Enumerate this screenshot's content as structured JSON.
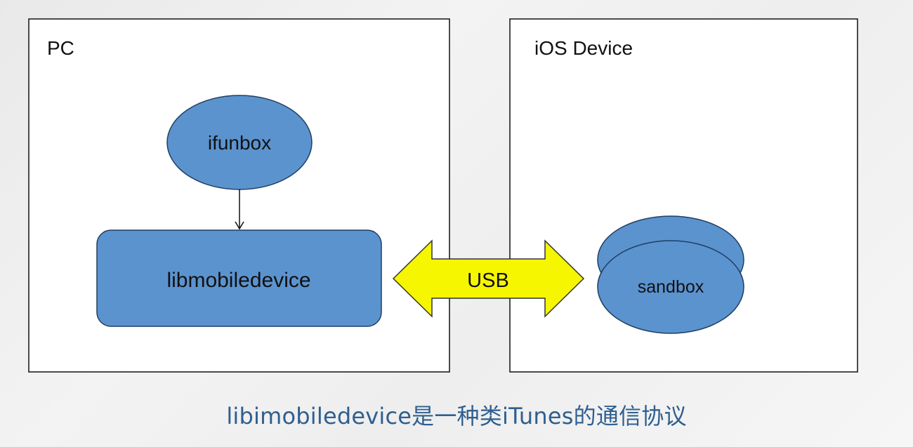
{
  "diagram": {
    "pc_label": "PC",
    "ios_label": "iOS Device",
    "ifunbox_label": "ifunbox",
    "libmobiledevice_label": "libmobiledevice",
    "usb_label": "USB",
    "sandbox_label": "sandbox"
  },
  "caption": "libimobiledevice是一种类iTunes的通信协议",
  "colors": {
    "node_fill": "#5b93cf",
    "node_stroke": "#1f3f63",
    "usb_fill": "#f6f600",
    "caption_text": "#2f5f8f"
  }
}
